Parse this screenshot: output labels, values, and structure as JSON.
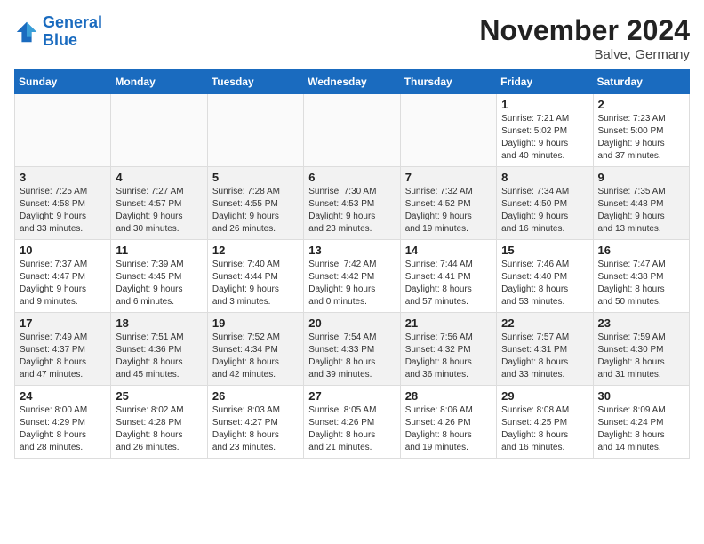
{
  "header": {
    "logo_line1": "General",
    "logo_line2": "Blue",
    "month_title": "November 2024",
    "location": "Balve, Germany"
  },
  "weekdays": [
    "Sunday",
    "Monday",
    "Tuesday",
    "Wednesday",
    "Thursday",
    "Friday",
    "Saturday"
  ],
  "weeks": [
    [
      {
        "day": "",
        "info": ""
      },
      {
        "day": "",
        "info": ""
      },
      {
        "day": "",
        "info": ""
      },
      {
        "day": "",
        "info": ""
      },
      {
        "day": "",
        "info": ""
      },
      {
        "day": "1",
        "info": "Sunrise: 7:21 AM\nSunset: 5:02 PM\nDaylight: 9 hours\nand 40 minutes."
      },
      {
        "day": "2",
        "info": "Sunrise: 7:23 AM\nSunset: 5:00 PM\nDaylight: 9 hours\nand 37 minutes."
      }
    ],
    [
      {
        "day": "3",
        "info": "Sunrise: 7:25 AM\nSunset: 4:58 PM\nDaylight: 9 hours\nand 33 minutes."
      },
      {
        "day": "4",
        "info": "Sunrise: 7:27 AM\nSunset: 4:57 PM\nDaylight: 9 hours\nand 30 minutes."
      },
      {
        "day": "5",
        "info": "Sunrise: 7:28 AM\nSunset: 4:55 PM\nDaylight: 9 hours\nand 26 minutes."
      },
      {
        "day": "6",
        "info": "Sunrise: 7:30 AM\nSunset: 4:53 PM\nDaylight: 9 hours\nand 23 minutes."
      },
      {
        "day": "7",
        "info": "Sunrise: 7:32 AM\nSunset: 4:52 PM\nDaylight: 9 hours\nand 19 minutes."
      },
      {
        "day": "8",
        "info": "Sunrise: 7:34 AM\nSunset: 4:50 PM\nDaylight: 9 hours\nand 16 minutes."
      },
      {
        "day": "9",
        "info": "Sunrise: 7:35 AM\nSunset: 4:48 PM\nDaylight: 9 hours\nand 13 minutes."
      }
    ],
    [
      {
        "day": "10",
        "info": "Sunrise: 7:37 AM\nSunset: 4:47 PM\nDaylight: 9 hours\nand 9 minutes."
      },
      {
        "day": "11",
        "info": "Sunrise: 7:39 AM\nSunset: 4:45 PM\nDaylight: 9 hours\nand 6 minutes."
      },
      {
        "day": "12",
        "info": "Sunrise: 7:40 AM\nSunset: 4:44 PM\nDaylight: 9 hours\nand 3 minutes."
      },
      {
        "day": "13",
        "info": "Sunrise: 7:42 AM\nSunset: 4:42 PM\nDaylight: 9 hours\nand 0 minutes."
      },
      {
        "day": "14",
        "info": "Sunrise: 7:44 AM\nSunset: 4:41 PM\nDaylight: 8 hours\nand 57 minutes."
      },
      {
        "day": "15",
        "info": "Sunrise: 7:46 AM\nSunset: 4:40 PM\nDaylight: 8 hours\nand 53 minutes."
      },
      {
        "day": "16",
        "info": "Sunrise: 7:47 AM\nSunset: 4:38 PM\nDaylight: 8 hours\nand 50 minutes."
      }
    ],
    [
      {
        "day": "17",
        "info": "Sunrise: 7:49 AM\nSunset: 4:37 PM\nDaylight: 8 hours\nand 47 minutes."
      },
      {
        "day": "18",
        "info": "Sunrise: 7:51 AM\nSunset: 4:36 PM\nDaylight: 8 hours\nand 45 minutes."
      },
      {
        "day": "19",
        "info": "Sunrise: 7:52 AM\nSunset: 4:34 PM\nDaylight: 8 hours\nand 42 minutes."
      },
      {
        "day": "20",
        "info": "Sunrise: 7:54 AM\nSunset: 4:33 PM\nDaylight: 8 hours\nand 39 minutes."
      },
      {
        "day": "21",
        "info": "Sunrise: 7:56 AM\nSunset: 4:32 PM\nDaylight: 8 hours\nand 36 minutes."
      },
      {
        "day": "22",
        "info": "Sunrise: 7:57 AM\nSunset: 4:31 PM\nDaylight: 8 hours\nand 33 minutes."
      },
      {
        "day": "23",
        "info": "Sunrise: 7:59 AM\nSunset: 4:30 PM\nDaylight: 8 hours\nand 31 minutes."
      }
    ],
    [
      {
        "day": "24",
        "info": "Sunrise: 8:00 AM\nSunset: 4:29 PM\nDaylight: 8 hours\nand 28 minutes."
      },
      {
        "day": "25",
        "info": "Sunrise: 8:02 AM\nSunset: 4:28 PM\nDaylight: 8 hours\nand 26 minutes."
      },
      {
        "day": "26",
        "info": "Sunrise: 8:03 AM\nSunset: 4:27 PM\nDaylight: 8 hours\nand 23 minutes."
      },
      {
        "day": "27",
        "info": "Sunrise: 8:05 AM\nSunset: 4:26 PM\nDaylight: 8 hours\nand 21 minutes."
      },
      {
        "day": "28",
        "info": "Sunrise: 8:06 AM\nSunset: 4:26 PM\nDaylight: 8 hours\nand 19 minutes."
      },
      {
        "day": "29",
        "info": "Sunrise: 8:08 AM\nSunset: 4:25 PM\nDaylight: 8 hours\nand 16 minutes."
      },
      {
        "day": "30",
        "info": "Sunrise: 8:09 AM\nSunset: 4:24 PM\nDaylight: 8 hours\nand 14 minutes."
      }
    ]
  ]
}
